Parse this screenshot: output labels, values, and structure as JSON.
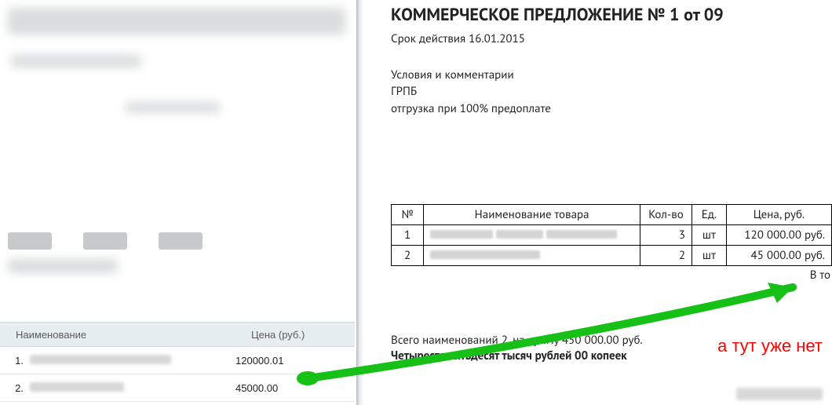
{
  "left": {
    "header_name": "Наименование",
    "header_price": "Цена (руб.)",
    "items": [
      {
        "index": "1.",
        "smudge_w": 180,
        "price": "120000.01"
      },
      {
        "index": "2.",
        "smudge_w": 120,
        "price": "45000.00"
      }
    ]
  },
  "doc": {
    "title": "КОММЕРЧЕСКОЕ ПРЕДЛОЖЕНИЕ № 1 от 09",
    "validity_label": "Срок действия 16.01.2015",
    "conditions_label": "Условия и комментарии",
    "company": "ГРПБ",
    "terms": "отгрузка при 100% предоплате",
    "table": {
      "headers": {
        "num": "№",
        "name": "Наименование товара",
        "qty": "Кол-во",
        "unit": "Ед.",
        "price": "Цена, руб."
      },
      "rows": [
        {
          "num": "1",
          "qty": "3",
          "unit": "шт",
          "price": "120 000.00 руб."
        },
        {
          "num": "2",
          "qty": "2",
          "unit": "шт",
          "price": "45 000.00 руб."
        }
      ],
      "after": "В то"
    },
    "summary_line": "Всего наименований 2, на сумму 450 000.00 руб.",
    "summary_words": "Четыреста пятьдесят тысяч рублей 00 копеек",
    "annotation": "а тут уже нет"
  }
}
